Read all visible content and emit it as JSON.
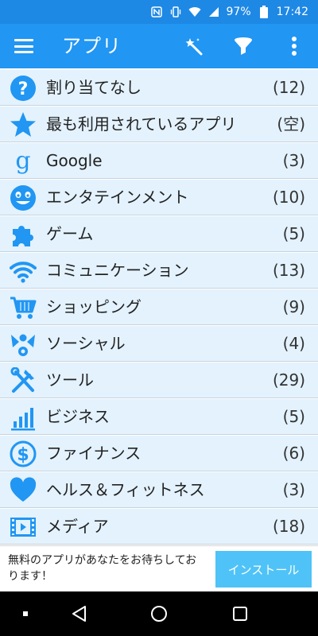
{
  "status_bar": {
    "battery": "97%",
    "time": "17:42",
    "icons": [
      "nfc-icon",
      "vibrate-icon",
      "wifi-icon",
      "signal-icon",
      "battery-icon"
    ]
  },
  "app_bar": {
    "title": "アプリ",
    "actions": [
      "menu-icon",
      "magic-wand-icon",
      "filter-icon",
      "more-vert-icon"
    ]
  },
  "categories": [
    {
      "label": "割り当てなし",
      "count": "(12)",
      "icon": "question-icon"
    },
    {
      "label": "最も利用されているアプリ",
      "count": "(空)",
      "icon": "star-icon"
    },
    {
      "label": "Google",
      "count": "(3)",
      "icon": "google-g-icon"
    },
    {
      "label": "エンタテインメント",
      "count": "(10)",
      "icon": "smiley-icon"
    },
    {
      "label": "ゲーム",
      "count": "(5)",
      "icon": "puzzle-icon"
    },
    {
      "label": "コミュニケーション",
      "count": "(13)",
      "icon": "wifi-icon"
    },
    {
      "label": "ショッピング",
      "count": "(9)",
      "icon": "cart-icon"
    },
    {
      "label": "ソーシャル",
      "count": "(4)",
      "icon": "social-icon"
    },
    {
      "label": "ツール",
      "count": "(29)",
      "icon": "tools-icon"
    },
    {
      "label": "ビジネス",
      "count": "(5)",
      "icon": "bar-chart-icon"
    },
    {
      "label": "ファイナンス",
      "count": "(6)",
      "icon": "dollar-icon"
    },
    {
      "label": "ヘルス＆フィットネス",
      "count": "(3)",
      "icon": "heart-icon"
    },
    {
      "label": "メディア",
      "count": "(18)",
      "icon": "film-icon"
    }
  ],
  "ad": {
    "text": "無料のアプリがあなたをお待ちしております！",
    "button": "インストール"
  },
  "nav_bar": {
    "items": [
      "recents-dot-icon",
      "back-icon",
      "home-icon",
      "overview-icon"
    ]
  },
  "colors": {
    "status_bar": "#1e88e5",
    "app_bar": "#2196f3",
    "row_bg": "#e3f2fd",
    "icon_blue": "#2196f3",
    "ad_button": "#4fc3f7"
  }
}
